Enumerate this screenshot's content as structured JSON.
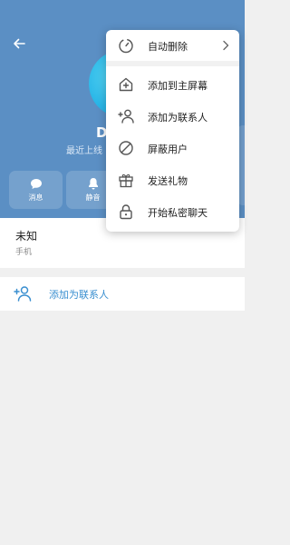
{
  "profile": {
    "name": "D",
    "last_seen": "最近上线"
  },
  "actions": [
    {
      "label": "消息",
      "icon": "message-icon"
    },
    {
      "label": "静音",
      "icon": "bell-icon"
    }
  ],
  "info": {
    "value": "未知",
    "label": "手机"
  },
  "add_contact": {
    "label": "添加为联系人",
    "icon": "add-user-icon"
  },
  "menu": {
    "top_item": {
      "label": "自动删除",
      "icon": "timer-icon"
    },
    "items": [
      {
        "label": "添加到主屏幕",
        "icon": "add-home-icon"
      },
      {
        "label": "添加为联系人",
        "icon": "add-user-icon"
      },
      {
        "label": "屏蔽用户",
        "icon": "block-icon"
      },
      {
        "label": "发送礼物",
        "icon": "gift-icon"
      },
      {
        "label": "开始私密聊天",
        "icon": "lock-icon"
      }
    ]
  },
  "colors": {
    "header": "#5b8fc4",
    "accent": "#3a8fd0",
    "avatar": "#2bb7e8"
  }
}
